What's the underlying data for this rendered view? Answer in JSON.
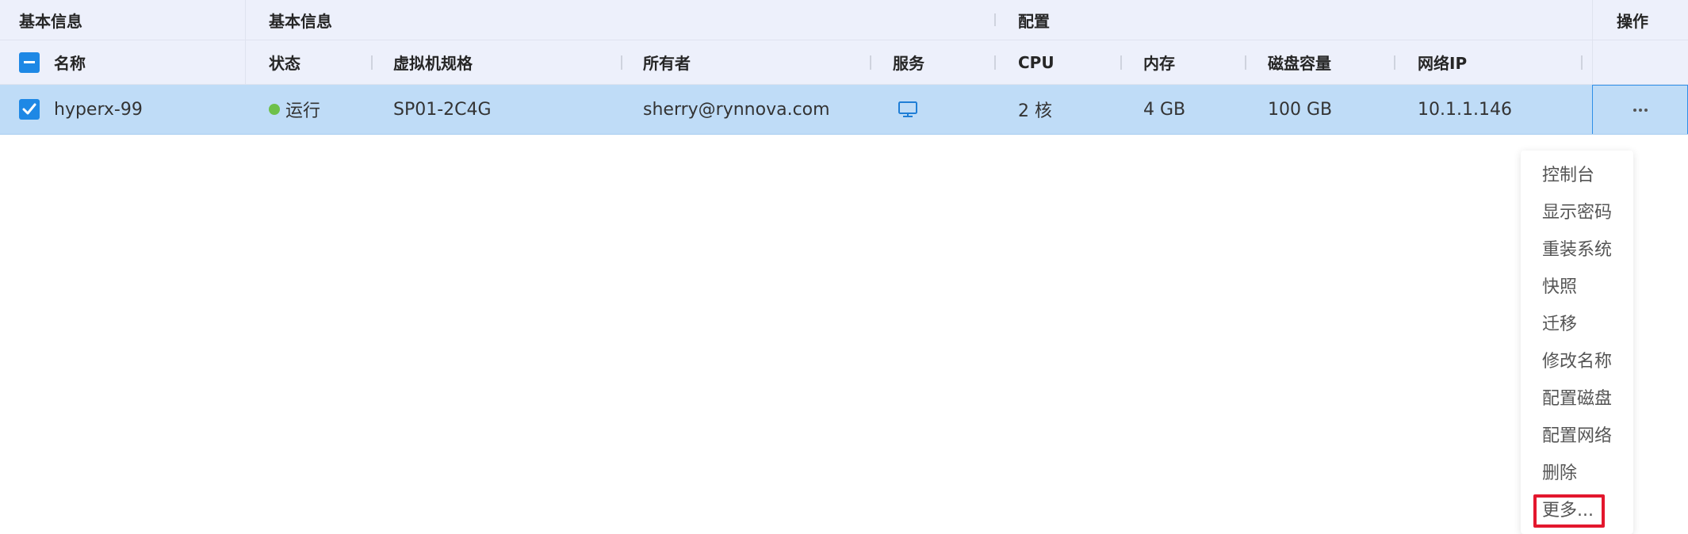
{
  "group_header": {
    "basic_info_1": "基本信息",
    "basic_info_2": "基本信息",
    "config": "配置",
    "actions": "操作"
  },
  "columns": {
    "name": "名称",
    "status": "状态",
    "vm_spec": "虚拟机规格",
    "owner": "所有者",
    "service": "服务",
    "cpu": "CPU",
    "memory": "内存",
    "disk": "磁盘容量",
    "network_ip": "网络IP"
  },
  "row": {
    "name": "hyperx-99",
    "status": "运行",
    "status_color": "#6ec04a",
    "vm_spec": "SP01-2C4G",
    "owner": "sherry@rynnova.com",
    "service_icon": "monitor-icon",
    "cpu": "2 核",
    "memory": "4 GB",
    "disk": "100 GB",
    "network_ip": "10.1.1.146",
    "selected": true
  },
  "action_menu": {
    "trigger_icon": "ellipsis-icon",
    "items": [
      "控制台",
      "显示密码",
      "重装系统",
      "快照",
      "迁移",
      "修改名称",
      "配置磁盘",
      "配置网络",
      "删除",
      "更多..."
    ],
    "highlighted_item": "更多..."
  },
  "colors": {
    "header_bg": "#edf0fb",
    "selected_row_bg": "#bfdcf7",
    "accent": "#1e88e5",
    "link": "#1f7ed6",
    "highlight_border": "#e3172d"
  }
}
